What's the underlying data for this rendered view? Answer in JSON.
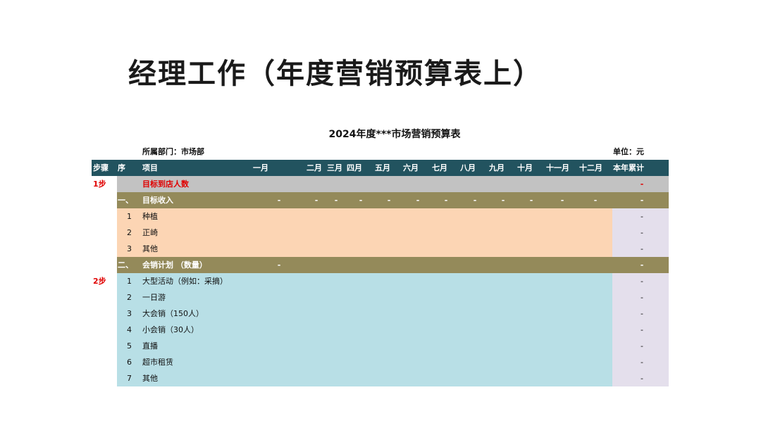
{
  "page": {
    "title": "经理工作（年度营销预算表上）",
    "subtitle": "2024年度***市场营销预算表",
    "department": "所属部门：市场部",
    "unit": "单位：元"
  },
  "header": {
    "step": "步骤",
    "seq": "序",
    "item": "项目",
    "months": [
      "一月",
      "二月",
      "三月",
      "四月",
      "五月",
      "六月",
      "七月",
      "八月",
      "九月",
      "十月",
      "十一月",
      "十二月"
    ],
    "total": "本年累计"
  },
  "rows": {
    "target_visitors": {
      "step": "1步",
      "item": "目标到店人数",
      "total": "-"
    },
    "section1": {
      "seq": "一、",
      "item": "目标收入",
      "dash": "-"
    },
    "income": [
      {
        "seq": "1",
        "item": "种植",
        "total": "-"
      },
      {
        "seq": "2",
        "item": "正崎",
        "total": "-"
      },
      {
        "seq": "3",
        "item": "其他",
        "total": "-"
      }
    ],
    "section2": {
      "seq": "二、",
      "item": "会销计划 （数量）",
      "dash": "-"
    },
    "plan_step": "2步",
    "plan": [
      {
        "seq": "1",
        "item": "大型活动（例如：采摘）",
        "total": "-"
      },
      {
        "seq": "2",
        "item": "一日游",
        "total": "-"
      },
      {
        "seq": "3",
        "item": "大会销（150人）",
        "total": "-"
      },
      {
        "seq": "4",
        "item": "小会销（30人）",
        "total": "-"
      },
      {
        "seq": "5",
        "item": "直播",
        "total": "-"
      },
      {
        "seq": "6",
        "item": "超市租赁",
        "total": "-"
      },
      {
        "seq": "7",
        "item": "其他",
        "total": "-"
      }
    ]
  },
  "colors": {
    "header_bg": "#22535f",
    "grey_band": "#c2c2c2",
    "olive_band": "#948a5a",
    "peach_band": "#fcd5b4",
    "blue_band": "#b8dfe6",
    "lavender_band": "#e4dfec",
    "step_red": "#e00000"
  }
}
